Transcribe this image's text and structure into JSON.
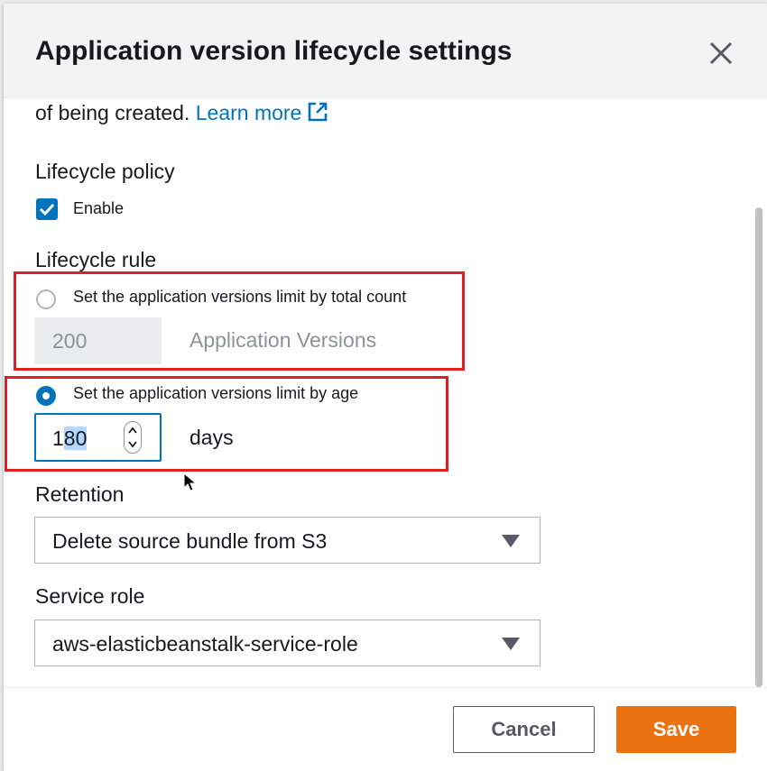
{
  "dialog": {
    "title": "Application version lifecycle settings"
  },
  "intro": {
    "text": "of being created. ",
    "learn_more": "Learn more"
  },
  "lifecycle_policy": {
    "label": "Lifecycle policy",
    "enable_label": "Enable",
    "enabled": true
  },
  "lifecycle_rule": {
    "label": "Lifecycle rule",
    "by_count": {
      "label": "Set the application versions limit by total count",
      "value": "200",
      "unit": "Application Versions",
      "selected": false
    },
    "by_age": {
      "label": "Set the application versions limit by age",
      "value_prefix": "1",
      "value_selected": "80",
      "unit": "days",
      "selected": true
    }
  },
  "retention": {
    "label": "Retention",
    "value": "Delete source bundle from S3"
  },
  "service_role": {
    "label": "Service role",
    "value": "aws-elasticbeanstalk-service-role"
  },
  "footer": {
    "cancel_label": "Cancel",
    "save_label": "Save"
  },
  "colors": {
    "accent": "#0073bb",
    "primary_button": "#ec7211",
    "highlight": "#e02020"
  }
}
